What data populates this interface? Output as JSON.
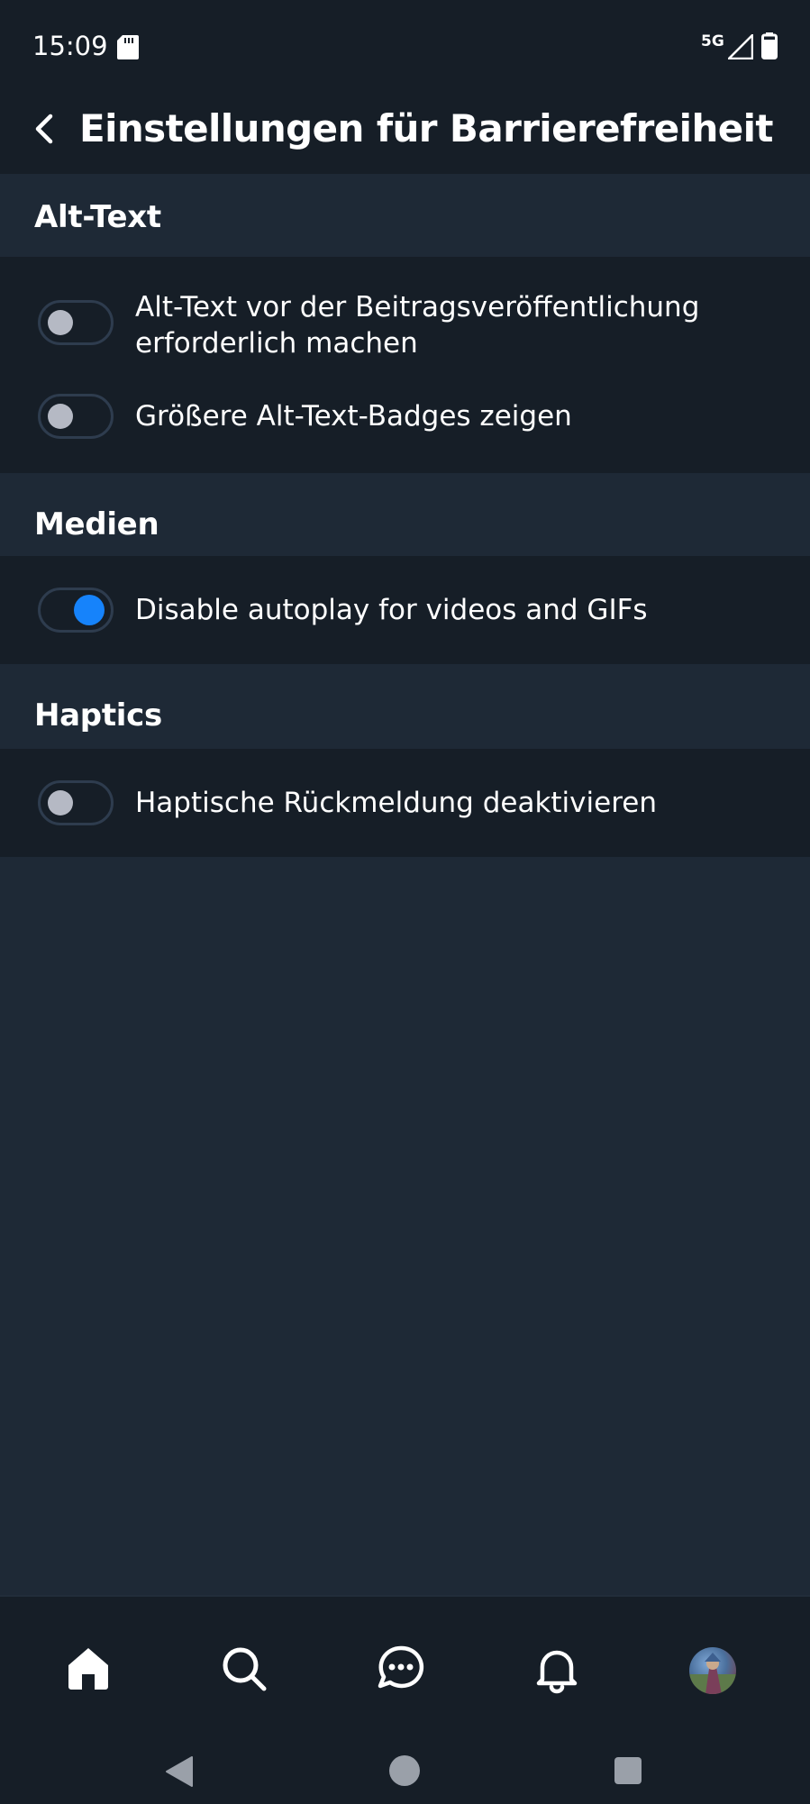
{
  "status_bar": {
    "time": "15:09",
    "network": "5G",
    "icons": [
      "sd-card-icon",
      "signal-icon",
      "battery-icon"
    ]
  },
  "header": {
    "back_icon": "chevron-left-icon",
    "title": "Einstellungen für Barrierefreiheit"
  },
  "sections": [
    {
      "title": "Alt-Text",
      "options": [
        {
          "label": "Alt-Text vor der Beitragsveröffentlichung erforderlich machen",
          "enabled": false
        },
        {
          "label": "Größere Alt-Text-Badges zeigen",
          "enabled": false
        }
      ]
    },
    {
      "title": "Medien",
      "options": [
        {
          "label": "Disable autoplay for videos and GIFs",
          "enabled": true
        }
      ]
    },
    {
      "title": "Haptics",
      "options": [
        {
          "label": "Haptische Rückmeldung deaktivieren",
          "enabled": false
        }
      ]
    }
  ],
  "bottom_nav": {
    "items": [
      "home-icon",
      "search-icon",
      "chat-icon",
      "bell-icon",
      "avatar"
    ]
  },
  "colors": {
    "background": "#1e2936",
    "surface": "#161e27",
    "accent": "#1683fb",
    "toggle_off_knob": "#b5b9c4"
  }
}
